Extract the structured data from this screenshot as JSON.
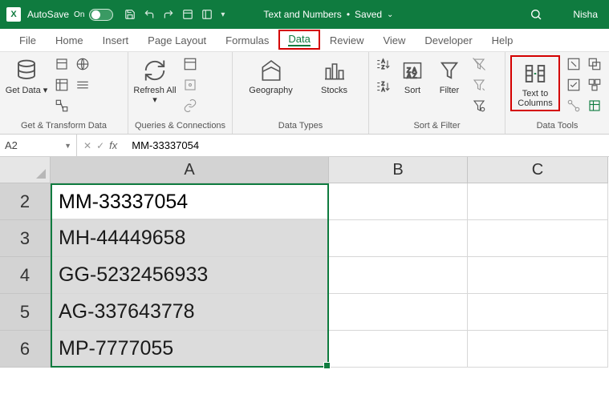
{
  "titlebar": {
    "autosave_label": "AutoSave",
    "autosave_state": "On",
    "doc_name": "Text and Numbers",
    "save_state": "Saved",
    "user_name": "Nisha"
  },
  "tabs": {
    "items": [
      "File",
      "Home",
      "Insert",
      "Page Layout",
      "Formulas",
      "Data",
      "Review",
      "View",
      "Developer",
      "Help"
    ],
    "active_index": 5
  },
  "ribbon": {
    "groups": {
      "get_transform": {
        "label": "Get & Transform Data",
        "get_data": "Get Data"
      },
      "queries": {
        "label": "Queries & Connections",
        "refresh_all": "Refresh All"
      },
      "data_types": {
        "label": "Data Types",
        "geography": "Geography",
        "stocks": "Stocks"
      },
      "sort_filter": {
        "label": "Sort & Filter",
        "sort": "Sort",
        "filter": "Filter"
      },
      "data_tools": {
        "label": "Data Tools",
        "text_to_columns": "Text to Columns"
      }
    }
  },
  "formula_bar": {
    "name_box": "A2",
    "value": "MM-33337054"
  },
  "columns": [
    "A",
    "B",
    "C"
  ],
  "rows": [
    {
      "num": 2,
      "a": "MM-33337054"
    },
    {
      "num": 3,
      "a": "MH-44449658"
    },
    {
      "num": 4,
      "a": "GG-5232456933"
    },
    {
      "num": 5,
      "a": "AG-337643778"
    },
    {
      "num": 6,
      "a": "MP-7777055"
    }
  ],
  "colors": {
    "accent": "#0f7b3f",
    "highlight": "#d40000"
  }
}
